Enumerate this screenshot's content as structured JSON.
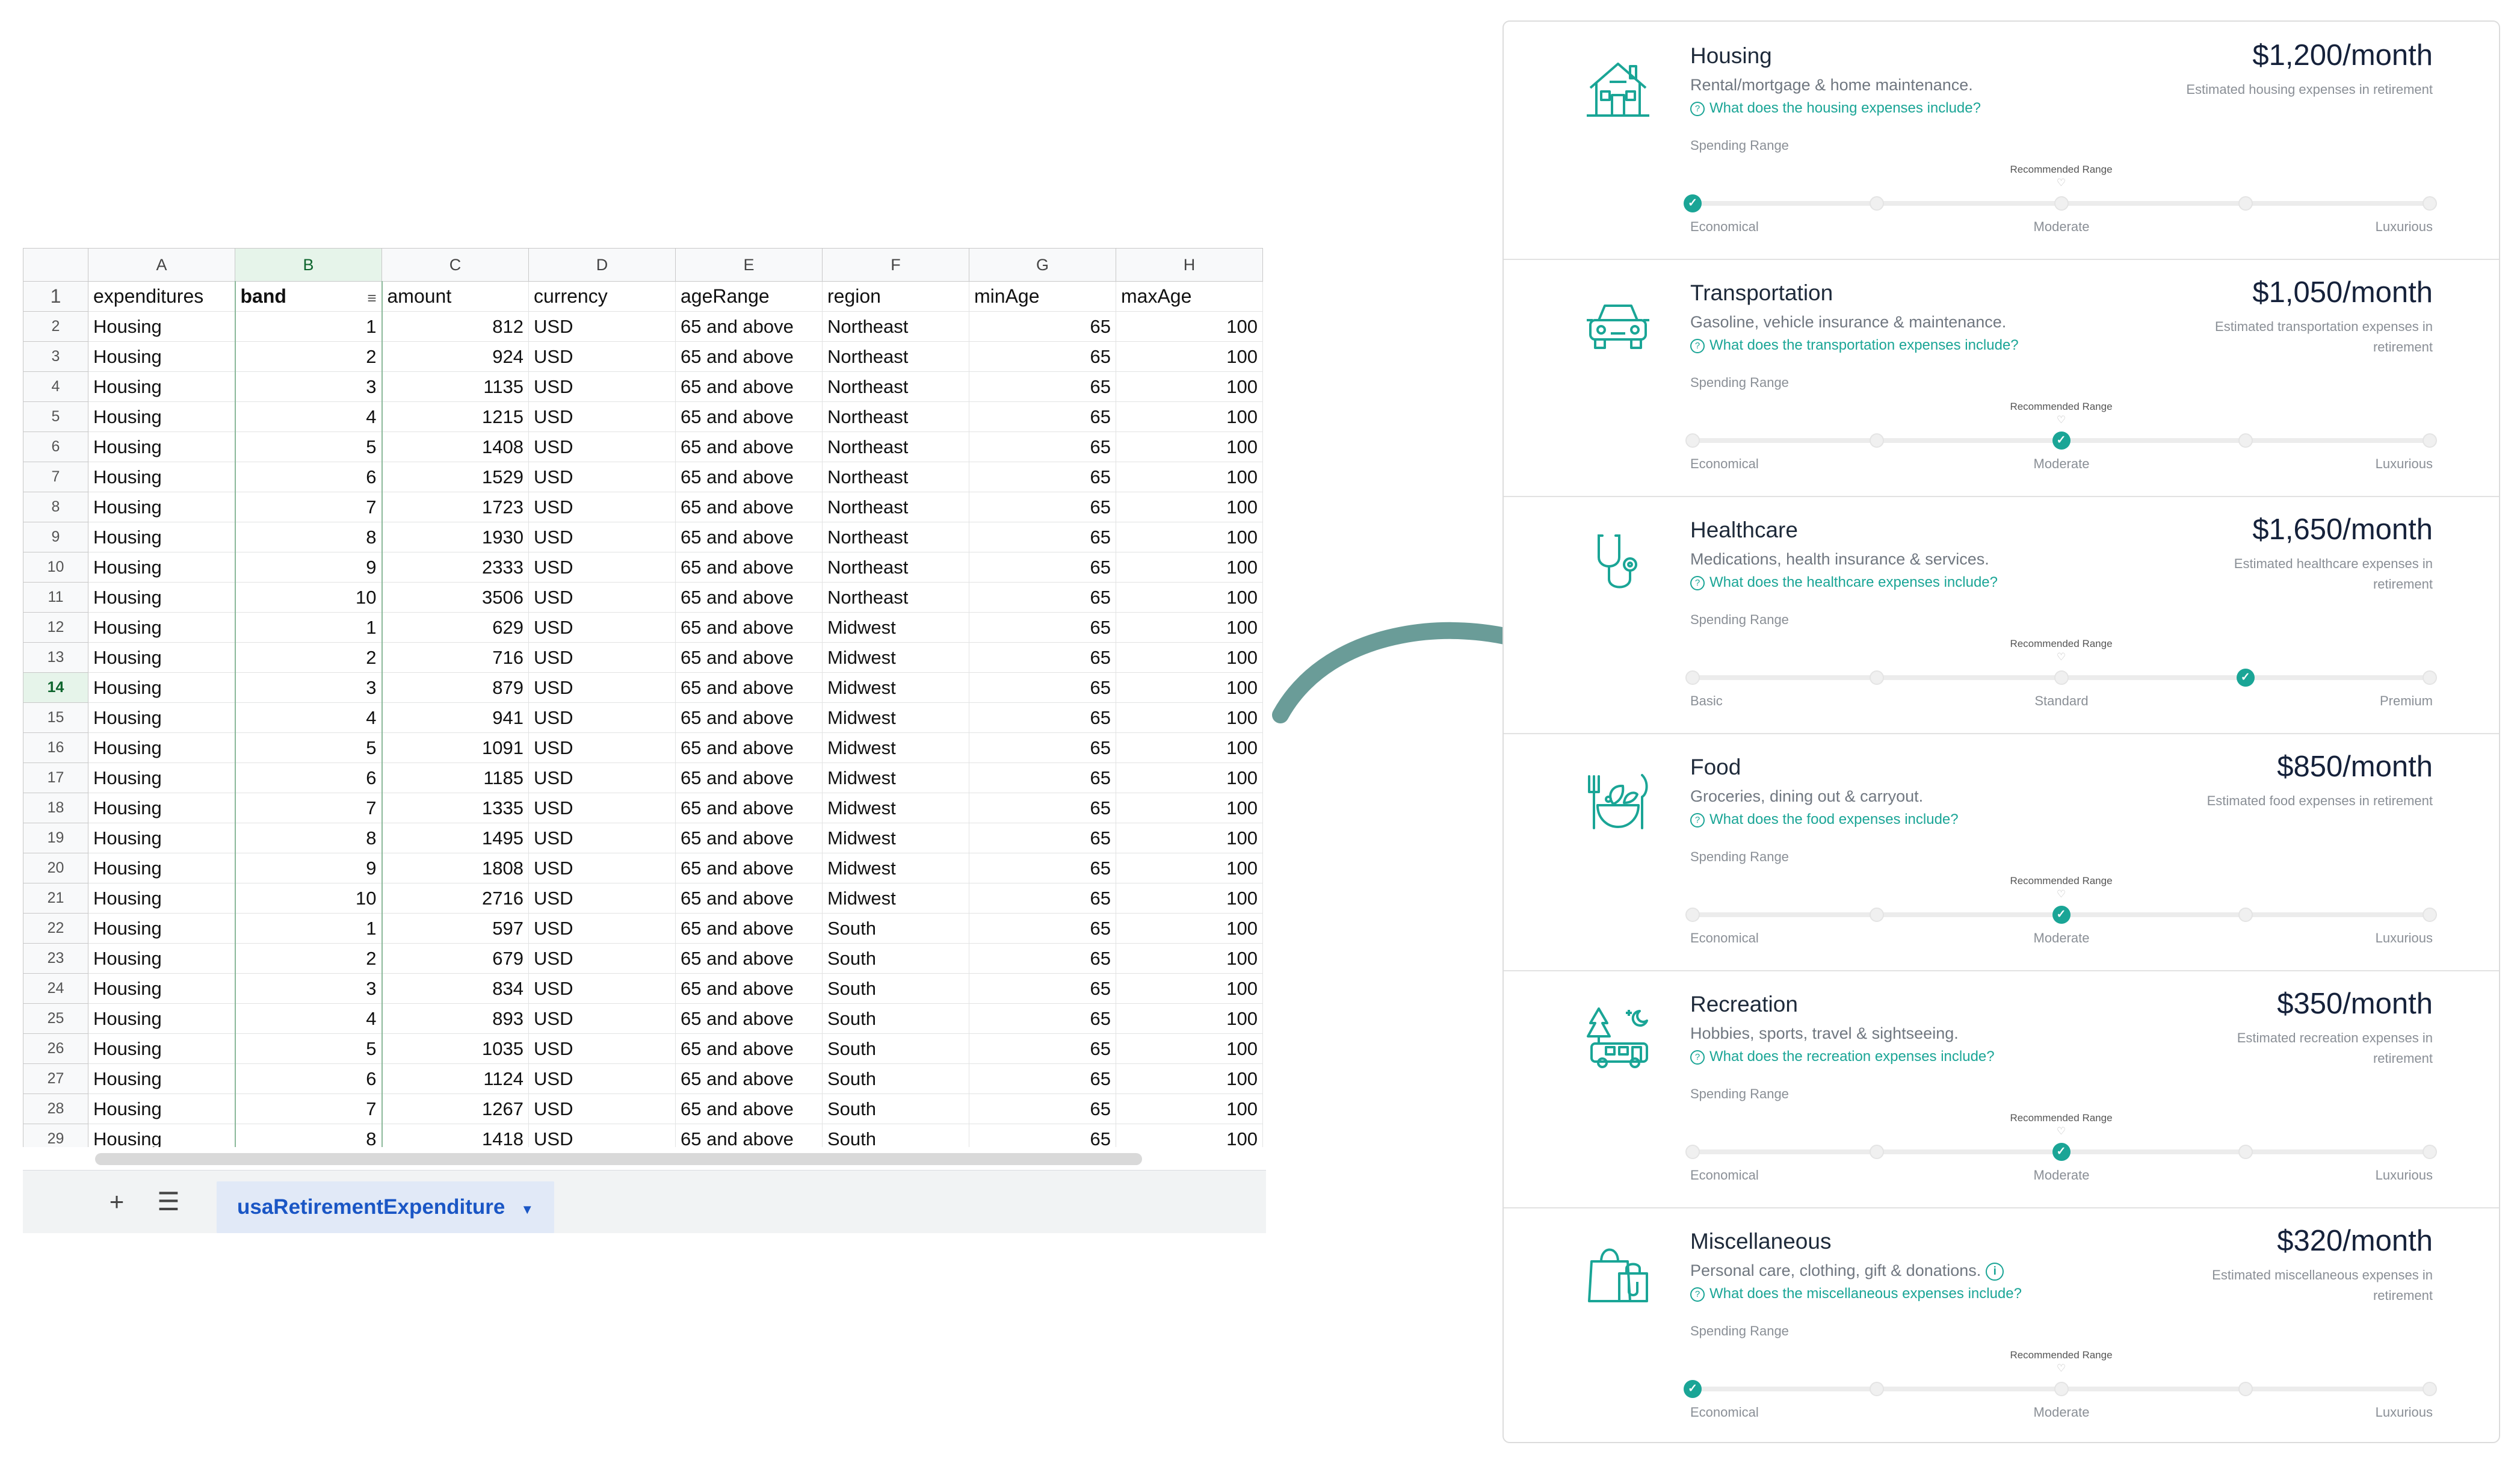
{
  "spreadsheet": {
    "column_letters": [
      "A",
      "B",
      "C",
      "D",
      "E",
      "F",
      "G",
      "H"
    ],
    "header_row": [
      "expenditures",
      "band",
      "amount",
      "currency",
      "ageRange",
      "region",
      "minAge",
      "maxAge"
    ],
    "row_numbers": [
      "1",
      "2",
      "3",
      "4",
      "5",
      "6",
      "7",
      "8",
      "9",
      "10",
      "11",
      "12",
      "13",
      "14",
      "15",
      "16",
      "17",
      "18",
      "19",
      "20",
      "21",
      "22",
      "23",
      "24",
      "25",
      "26",
      "27",
      "28",
      "29"
    ],
    "rows": [
      [
        "Housing",
        "1",
        "812",
        "USD",
        "65 and above",
        "Northeast",
        "65",
        "100"
      ],
      [
        "Housing",
        "2",
        "924",
        "USD",
        "65 and above",
        "Northeast",
        "65",
        "100"
      ],
      [
        "Housing",
        "3",
        "1135",
        "USD",
        "65 and above",
        "Northeast",
        "65",
        "100"
      ],
      [
        "Housing",
        "4",
        "1215",
        "USD",
        "65 and above",
        "Northeast",
        "65",
        "100"
      ],
      [
        "Housing",
        "5",
        "1408",
        "USD",
        "65 and above",
        "Northeast",
        "65",
        "100"
      ],
      [
        "Housing",
        "6",
        "1529",
        "USD",
        "65 and above",
        "Northeast",
        "65",
        "100"
      ],
      [
        "Housing",
        "7",
        "1723",
        "USD",
        "65 and above",
        "Northeast",
        "65",
        "100"
      ],
      [
        "Housing",
        "8",
        "1930",
        "USD",
        "65 and above",
        "Northeast",
        "65",
        "100"
      ],
      [
        "Housing",
        "9",
        "2333",
        "USD",
        "65 and above",
        "Northeast",
        "65",
        "100"
      ],
      [
        "Housing",
        "10",
        "3506",
        "USD",
        "65 and above",
        "Northeast",
        "65",
        "100"
      ],
      [
        "Housing",
        "1",
        "629",
        "USD",
        "65 and above",
        "Midwest",
        "65",
        "100"
      ],
      [
        "Housing",
        "2",
        "716",
        "USD",
        "65 and above",
        "Midwest",
        "65",
        "100"
      ],
      [
        "Housing",
        "3",
        "879",
        "USD",
        "65 and above",
        "Midwest",
        "65",
        "100"
      ],
      [
        "Housing",
        "4",
        "941",
        "USD",
        "65 and above",
        "Midwest",
        "65",
        "100"
      ],
      [
        "Housing",
        "5",
        "1091",
        "USD",
        "65 and above",
        "Midwest",
        "65",
        "100"
      ],
      [
        "Housing",
        "6",
        "1185",
        "USD",
        "65 and above",
        "Midwest",
        "65",
        "100"
      ],
      [
        "Housing",
        "7",
        "1335",
        "USD",
        "65 and above",
        "Midwest",
        "65",
        "100"
      ],
      [
        "Housing",
        "8",
        "1495",
        "USD",
        "65 and above",
        "Midwest",
        "65",
        "100"
      ],
      [
        "Housing",
        "9",
        "1808",
        "USD",
        "65 and above",
        "Midwest",
        "65",
        "100"
      ],
      [
        "Housing",
        "10",
        "2716",
        "USD",
        "65 and above",
        "Midwest",
        "65",
        "100"
      ],
      [
        "Housing",
        "1",
        "597",
        "USD",
        "65 and above",
        "South",
        "65",
        "100"
      ],
      [
        "Housing",
        "2",
        "679",
        "USD",
        "65 and above",
        "South",
        "65",
        "100"
      ],
      [
        "Housing",
        "3",
        "834",
        "USD",
        "65 and above",
        "South",
        "65",
        "100"
      ],
      [
        "Housing",
        "4",
        "893",
        "USD",
        "65 and above",
        "South",
        "65",
        "100"
      ],
      [
        "Housing",
        "5",
        "1035",
        "USD",
        "65 and above",
        "South",
        "65",
        "100"
      ],
      [
        "Housing",
        "6",
        "1124",
        "USD",
        "65 and above",
        "South",
        "65",
        "100"
      ],
      [
        "Housing",
        "7",
        "1267",
        "USD",
        "65 and above",
        "South",
        "65",
        "100"
      ],
      [
        "Housing",
        "8",
        "1418",
        "USD",
        "65 and above",
        "South",
        "65",
        "100"
      ]
    ],
    "selected_row": "14",
    "selected_column": "B",
    "sheet_tab_label": "usaRetirementExpenditure"
  },
  "colors": {
    "accent_teal": "#1aa596",
    "arrow": "#6a9c98",
    "sheet_tab_text": "#1a56c5"
  },
  "cards": [
    {
      "icon": "house-icon",
      "title": "Housing",
      "description": "Rental/mortgage & home maintenance.",
      "link": "What does the housing expenses include?",
      "price": "$1,200/month",
      "price_note": "Estimated housing expenses in retirement",
      "spending_label": "Spending Range",
      "recommended_label": "Recommended Range",
      "tick_labels": [
        "Economical",
        "Moderate",
        "Luxurious"
      ],
      "selected_step": 1,
      "recommended_step": 3
    },
    {
      "icon": "car-icon",
      "title": "Transportation",
      "description": "Gasoline, vehicle insurance & maintenance.",
      "link": "What does the transportation expenses include?",
      "price": "$1,050/month",
      "price_note": "Estimated transportation expenses in retirement",
      "spending_label": "Spending Range",
      "recommended_label": "Recommended Range",
      "tick_labels": [
        "Economical",
        "Moderate",
        "Luxurious"
      ],
      "selected_step": 3,
      "recommended_step": 3
    },
    {
      "icon": "stethoscope-icon",
      "title": "Healthcare",
      "description": "Medications, health insurance & services.",
      "link": "What does the healthcare expenses include?",
      "price": "$1,650/month",
      "price_note": "Estimated healthcare expenses in retirement",
      "spending_label": "Spending Range",
      "recommended_label": "Recommended Range",
      "tick_labels": [
        "Basic",
        "Standard",
        "Premium"
      ],
      "selected_step": 4,
      "recommended_step": 3
    },
    {
      "icon": "food-bowl-icon",
      "title": "Food",
      "description": "Groceries, dining out & carryout.",
      "link": "What does the food expenses include?",
      "price": "$850/month",
      "price_note": "Estimated food expenses in retirement",
      "spending_label": "Spending Range",
      "recommended_label": "Recommended Range",
      "tick_labels": [
        "Economical",
        "Moderate",
        "Luxurious"
      ],
      "selected_step": 3,
      "recommended_step": 3
    },
    {
      "icon": "camper-van-icon",
      "title": "Recreation",
      "description": "Hobbies, sports, travel & sightseeing.",
      "link": "What does the recreation expenses include?",
      "price": "$350/month",
      "price_note": "Estimated recreation expenses in retirement",
      "spending_label": "Spending Range",
      "recommended_label": "Recommended Range",
      "tick_labels": [
        "Economical",
        "Moderate",
        "Luxurious"
      ],
      "selected_step": 3,
      "recommended_step": 3
    },
    {
      "icon": "shopping-bag-icon",
      "title": "Miscellaneous",
      "description": "Personal care, clothing, gift & donations.",
      "has_info": true,
      "link": "What does the miscellaneous expenses include?",
      "price": "$320/month",
      "price_note": "Estimated miscellaneous expenses in retirement",
      "spending_label": "Spending Range",
      "recommended_label": "Recommended Range",
      "tick_labels": [
        "Economical",
        "Moderate",
        "Luxurious"
      ],
      "selected_step": 1,
      "recommended_step": 3
    }
  ]
}
